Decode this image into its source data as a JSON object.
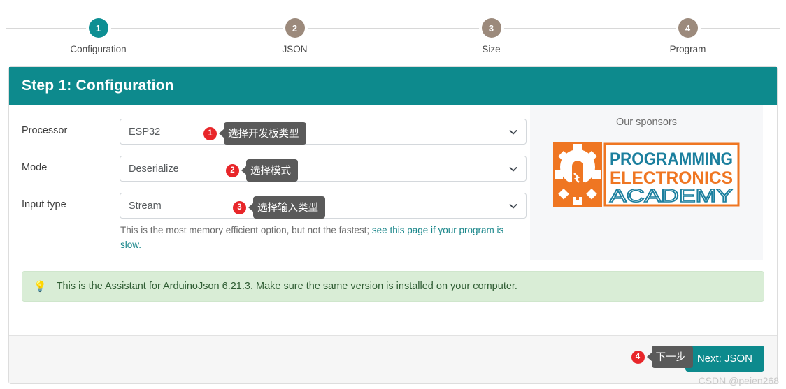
{
  "stepper": {
    "steps": [
      {
        "number": "1",
        "label": "Configuration",
        "state": "active"
      },
      {
        "number": "2",
        "label": "JSON",
        "state": "inactive"
      },
      {
        "number": "3",
        "label": "Size",
        "state": "inactive"
      },
      {
        "number": "4",
        "label": "Program",
        "state": "inactive"
      }
    ]
  },
  "card": {
    "header_title": "Step 1: Configuration"
  },
  "form": {
    "fields": [
      {
        "label": "Processor",
        "value": "ESP32",
        "icon": "chevron-down-icon",
        "annotation": {
          "badge": "1",
          "tip": "选择开发板类型"
        }
      },
      {
        "label": "Mode",
        "value": "Deserialize",
        "icon": "chevron-down-icon",
        "annotation": {
          "badge": "2",
          "tip": "选择模式"
        }
      },
      {
        "label": "Input type",
        "value": "Stream",
        "icon": "chevron-down-icon",
        "annotation": {
          "badge": "3",
          "tip": "选择输入类型"
        }
      }
    ],
    "help_text_before": "This is the most memory efficient option, but not the fastest; ",
    "help_link": "see this page if your program is slow."
  },
  "sponsors": {
    "title": "Our sponsors",
    "logo_name": "programming-electronics-academy-logo",
    "logo_lines": [
      "PROGRAMMING",
      "ELECTRONICS",
      "ACADEMY"
    ],
    "logo_colors": {
      "orange": "#ef7622",
      "teal": "#1b7f9e"
    }
  },
  "alert": {
    "icon": "lightbulb-icon",
    "icon_glyph": "💡",
    "text": "This is the Assistant for ArduinoJson 6.21.3. Make sure the same version is installed on your computer."
  },
  "footer": {
    "next_label": "Next: JSON",
    "annotation": {
      "badge": "4",
      "tip": "下一步"
    }
  },
  "watermark": {
    "text": "CSDN @peien268"
  },
  "colors": {
    "accent_teal": "#0d8a8d",
    "step_inactive": "#9c8a7c",
    "badge_red": "#e8262a",
    "tooltip_gray": "#5a5a5a",
    "alert_green_bg": "#d9edd6"
  }
}
